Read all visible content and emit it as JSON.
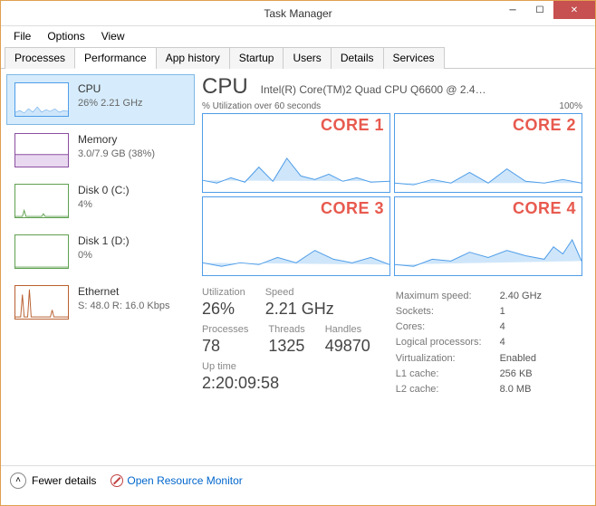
{
  "window": {
    "title": "Task Manager"
  },
  "menu": [
    "File",
    "Options",
    "View"
  ],
  "tabs": [
    "Processes",
    "Performance",
    "App history",
    "Startup",
    "Users",
    "Details",
    "Services"
  ],
  "active_tab": 1,
  "sidebar": [
    {
      "name": "CPU",
      "sub": "26% 2.21 GHz",
      "color": "#4f9de8"
    },
    {
      "name": "Memory",
      "sub": "3.0/7.9 GB (38%)",
      "color": "#8a4fa0"
    },
    {
      "name": "Disk 0 (C:)",
      "sub": "4%",
      "color": "#5fa050"
    },
    {
      "name": "Disk 1 (D:)",
      "sub": "0%",
      "color": "#5fa050"
    },
    {
      "name": "Ethernet",
      "sub": "S: 48.0 R: 16.0 Kbps",
      "color": "#b86030"
    }
  ],
  "main": {
    "title": "CPU",
    "subtitle": "Intel(R) Core(TM)2 Quad CPU Q6600 @ 2.4…",
    "chart_meta_left": "% Utilization over 60 seconds",
    "chart_meta_right": "100%",
    "cores": [
      "CORE 1",
      "CORE 2",
      "CORE 3",
      "CORE 4"
    ],
    "stats": {
      "utilization_label": "Utilization",
      "utilization": "26%",
      "speed_label": "Speed",
      "speed": "2.21 GHz",
      "processes_label": "Processes",
      "processes": "78",
      "threads_label": "Threads",
      "threads": "1325",
      "handles_label": "Handles",
      "handles": "49870",
      "uptime_label": "Up time",
      "uptime": "2:20:09:58"
    },
    "info": [
      [
        "Maximum speed:",
        "2.40 GHz"
      ],
      [
        "Sockets:",
        "1"
      ],
      [
        "Cores:",
        "4"
      ],
      [
        "Logical processors:",
        "4"
      ],
      [
        "Virtualization:",
        "Enabled"
      ],
      [
        "L1 cache:",
        "256 KB"
      ],
      [
        "L2 cache:",
        "8.0 MB"
      ]
    ]
  },
  "footer": {
    "fewer": "Fewer details",
    "resmon": "Open Resource Monitor"
  },
  "chart_data": {
    "type": "line",
    "note": "Approximate CPU % utilization over 60s, per core, read from sparkline heights (0-100%)",
    "x_seconds": [
      0,
      5,
      10,
      15,
      20,
      25,
      30,
      35,
      40,
      45,
      50,
      55,
      60
    ],
    "series": [
      {
        "name": "CORE 1",
        "values": [
          15,
          10,
          18,
          12,
          30,
          14,
          40,
          20,
          15,
          22,
          14,
          18,
          12
        ]
      },
      {
        "name": "CORE 2",
        "values": [
          12,
          8,
          14,
          10,
          22,
          12,
          28,
          16,
          12,
          20,
          10,
          14,
          10
        ]
      },
      {
        "name": "CORE 3",
        "values": [
          18,
          12,
          16,
          14,
          24,
          16,
          32,
          22,
          18,
          26,
          16,
          20,
          14
        ]
      },
      {
        "name": "CORE 4",
        "values": [
          14,
          10,
          20,
          18,
          28,
          22,
          30,
          24,
          20,
          34,
          26,
          40,
          18
        ]
      }
    ],
    "ylim": [
      0,
      100
    ]
  }
}
